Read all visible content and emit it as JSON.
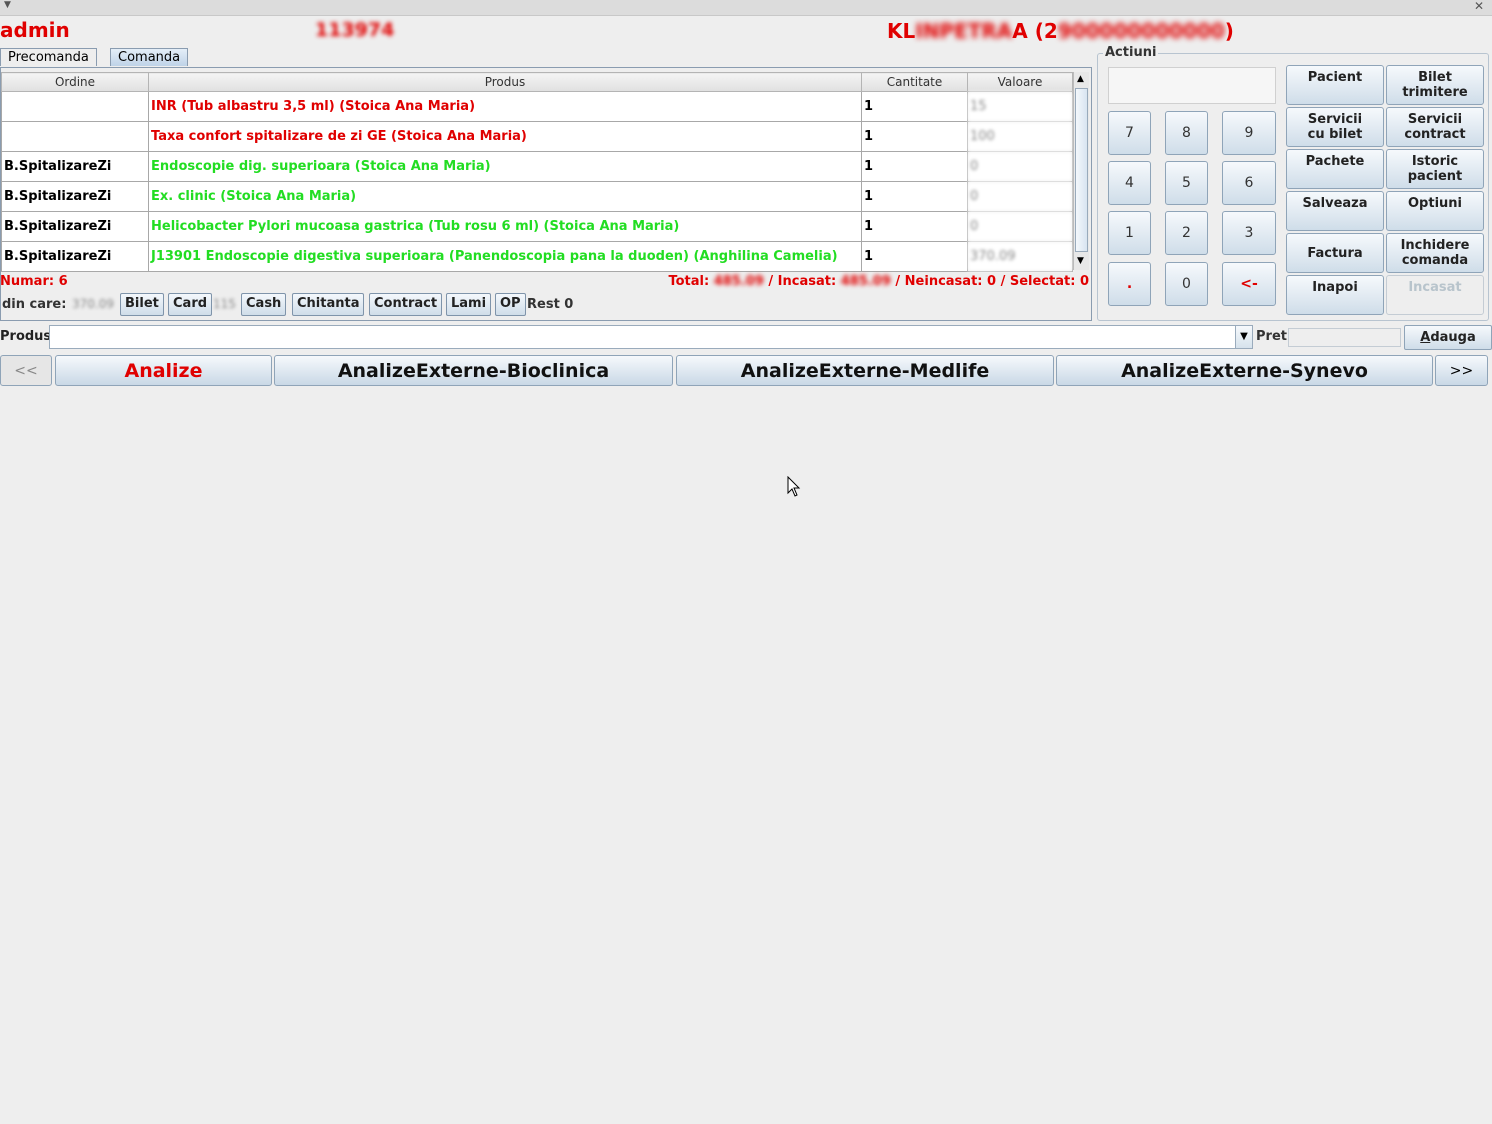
{
  "header": {
    "user": "admin",
    "order_id": "113974",
    "patient_visible": "KL",
    "patient_blurred": "INPETRA",
    "patient_tail": "A (",
    "patient_code_visible": "2",
    "patient_code_blurred": "900000000000",
    "patient_close": ")"
  },
  "tabs": [
    "Precomanda",
    "Comanda"
  ],
  "table": {
    "columns": [
      "Ordine",
      "Produs",
      "Cantitate",
      "Valoare"
    ],
    "rows": [
      {
        "ordine": "",
        "produs": "INR (Tub albastru 3,5 ml) (Stoica Ana Maria)",
        "cantitate": "1",
        "valoare": "15",
        "color": "red"
      },
      {
        "ordine": "",
        "produs": "Taxa confort spitalizare de zi GE (Stoica Ana Maria)",
        "cantitate": "1",
        "valoare": "100",
        "color": "red"
      },
      {
        "ordine": "B.SpitalizareZi",
        "produs": "Endoscopie dig. superioara (Stoica Ana Maria)",
        "cantitate": "1",
        "valoare": "0",
        "color": "green"
      },
      {
        "ordine": "B.SpitalizareZi",
        "produs": "Ex. clinic (Stoica Ana Maria)",
        "cantitate": "1",
        "valoare": "0",
        "color": "green"
      },
      {
        "ordine": "B.SpitalizareZi",
        "produs": "Helicobacter Pylori mucoasa gastrica (Tub rosu 6 ml) (Stoica Ana Maria)",
        "cantitate": "1",
        "valoare": "0",
        "color": "green"
      },
      {
        "ordine": "B.SpitalizareZi",
        "produs": "J13901 Endoscopie digestiva superioara (Panendoscopia pana la duoden)  (Anghilina Camelia)",
        "cantitate": "1",
        "valoare": "370.09",
        "color": "green"
      }
    ]
  },
  "summary": {
    "numar": "Numar:  6",
    "total_label": "Total: ",
    "total_value": "485.09",
    "incasat_label": " / Incasat: ",
    "incasat_value": "485.09",
    "rest_text": " / Neincasat: 0 / Selectat: 0",
    "din_care": "din care:",
    "din_care_value": "370.09",
    "card_value": "115",
    "rest": "Rest 0"
  },
  "payment_buttons": [
    "Bilet",
    "Card",
    "Cash",
    "Chitanta",
    "Contract",
    "Lami",
    "OP"
  ],
  "actions": {
    "title": "Actiuni",
    "keypad": [
      "7",
      "8",
      "9",
      "4",
      "5",
      "6",
      "1",
      "2",
      "3",
      ".",
      "0",
      "<-"
    ],
    "buttons": [
      "Pacient",
      "Bilet\ntrimitere",
      "Servicii\ncu bilet",
      "Servicii\ncontract",
      "Pachete",
      "Istoric\npacient",
      "Salveaza",
      "Optiuni",
      "Factura",
      "Inchidere\ncomanda",
      "Inapoi",
      "Incasat"
    ]
  },
  "produs_bar": {
    "label": "Produs",
    "input_value": "",
    "pret_label": "Pret",
    "add_button": "Adauga",
    "add_mnemonic": "A",
    "add_rest": "dauga"
  },
  "categories": {
    "prev": "<<",
    "next": ">>",
    "items": [
      "Analize",
      "AnalizeExterne-Bioclinica",
      "AnalizeExterne-Medlife",
      "AnalizeExterne-Synevo"
    ]
  }
}
